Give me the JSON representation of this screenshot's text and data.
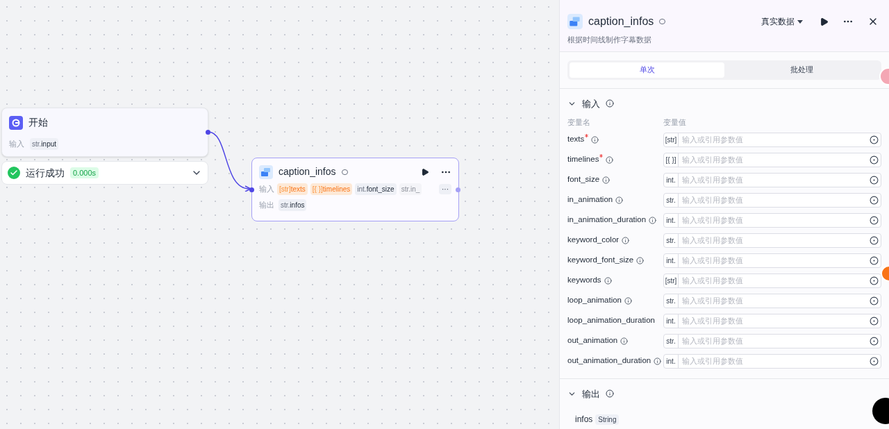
{
  "start_node": {
    "title": "开始",
    "io_label": "输入",
    "params": [
      {
        "type": "str.",
        "name": "input"
      }
    ],
    "run_status": {
      "text": "运行成功",
      "time": "0.000s",
      "success": true
    }
  },
  "caption_node": {
    "title": "caption_infos",
    "input_label": "输入",
    "output_label": "输出",
    "inputs": [
      {
        "type": "[str]",
        "name": "texts",
        "kind": "required"
      },
      {
        "type": "[{ }]",
        "name": "timelines",
        "kind": "required"
      },
      {
        "type": "int.",
        "name": "font_size",
        "kind": "normal"
      },
      {
        "type": "str.",
        "name": "in_",
        "kind": "faded"
      }
    ],
    "more": "···",
    "outputs": [
      {
        "type": "str.",
        "name": "infos"
      }
    ]
  },
  "panel": {
    "title": "caption_infos",
    "description": "根据时间线制作字幕数据",
    "data_mode": "真实数据",
    "tabs": [
      {
        "label": "单次",
        "selected": true
      },
      {
        "label": "批处理",
        "selected": false
      }
    ],
    "input_section": {
      "title": "输入",
      "expanded": true,
      "col_name": "变量名",
      "col_value": "变量值",
      "rows": [
        {
          "name": "texts",
          "required": true,
          "info": true,
          "type": "[str]",
          "placeholder": "输入或引用参数值"
        },
        {
          "name": "timelines",
          "required": true,
          "info": true,
          "type": "[{ }]",
          "placeholder": "输入或引用参数值"
        },
        {
          "name": "font_size",
          "required": false,
          "info": true,
          "type": "int.",
          "placeholder": "输入或引用参数值"
        },
        {
          "name": "in_animation",
          "required": false,
          "info": true,
          "type": "str.",
          "placeholder": "输入或引用参数值"
        },
        {
          "name": "in_animation_duration",
          "required": false,
          "info": true,
          "type": "int.",
          "placeholder": "输入或引用参数值"
        },
        {
          "name": "keyword_color",
          "required": false,
          "info": true,
          "type": "str.",
          "placeholder": "输入或引用参数值"
        },
        {
          "name": "keyword_font_size",
          "required": false,
          "info": true,
          "type": "int.",
          "placeholder": "输入或引用参数值"
        },
        {
          "name": "keywords",
          "required": false,
          "info": true,
          "type": "[str]",
          "placeholder": "输入或引用参数值"
        },
        {
          "name": "loop_animation",
          "required": false,
          "info": true,
          "type": "str.",
          "placeholder": "输入或引用参数值"
        },
        {
          "name": "loop_animation_duration",
          "required": false,
          "info": false,
          "type": "int.",
          "placeholder": "输入或引用参数值"
        },
        {
          "name": "out_animation",
          "required": false,
          "info": true,
          "type": "str.",
          "placeholder": "输入或引用参数值"
        },
        {
          "name": "out_animation_duration",
          "required": false,
          "info": true,
          "type": "int.",
          "placeholder": "输入或引用参数值"
        }
      ]
    },
    "output_section": {
      "title": "输出",
      "expanded": true,
      "outputs": [
        {
          "name": "infos",
          "type": "String"
        }
      ]
    }
  }
}
